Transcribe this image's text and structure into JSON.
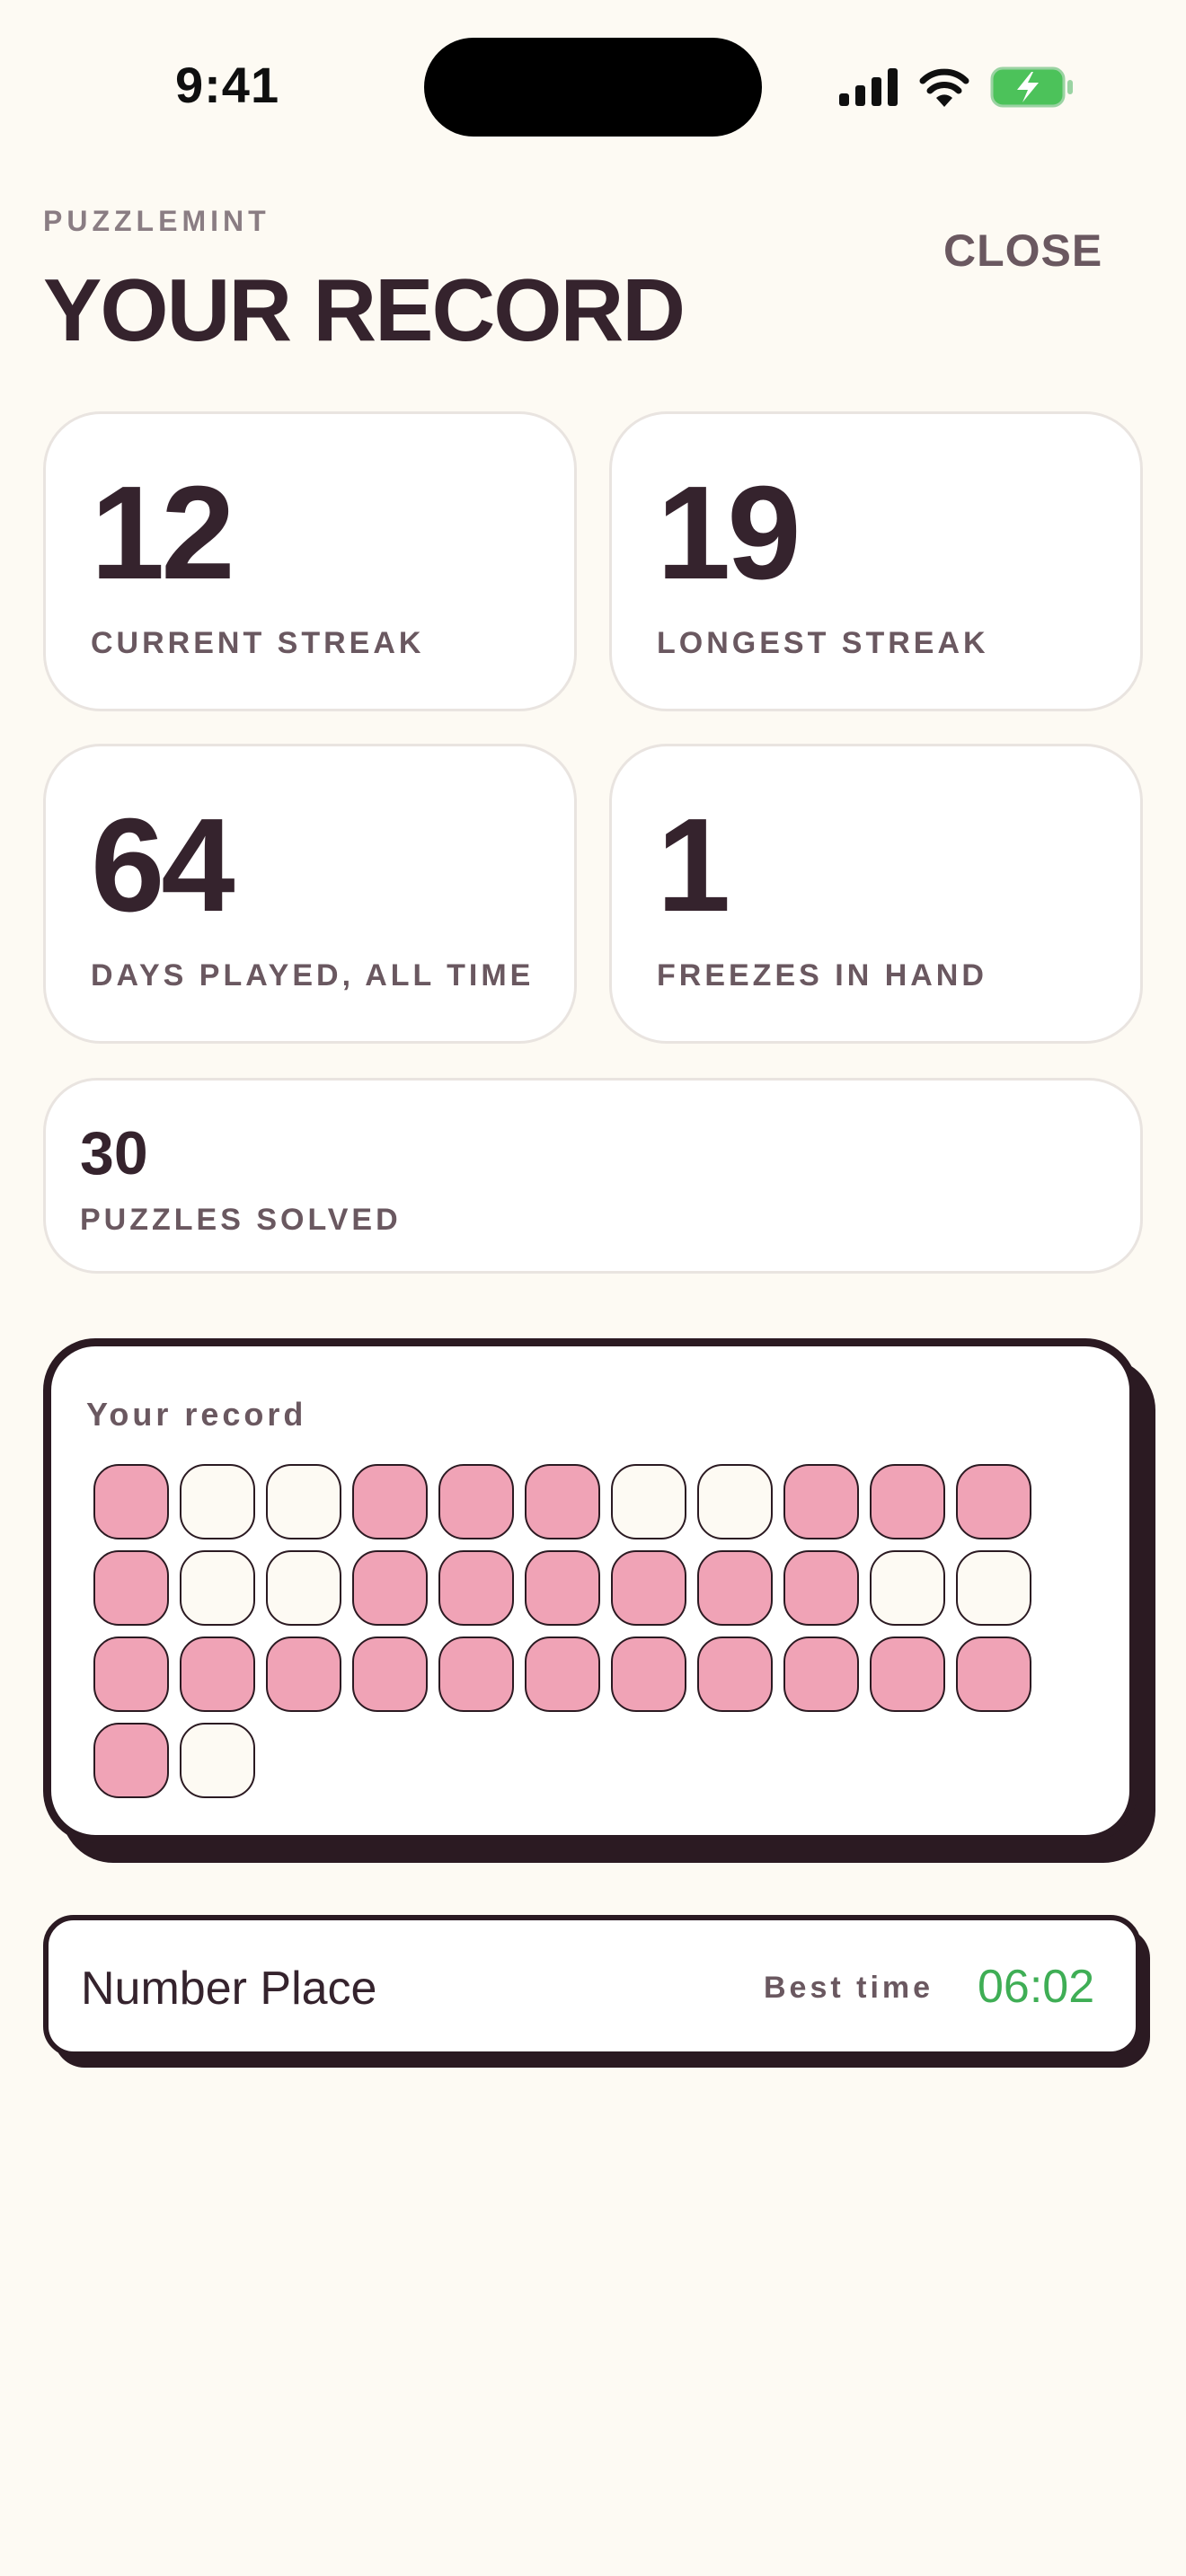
{
  "status_bar": {
    "time": "9:41",
    "icons": [
      "cellular-signal-icon",
      "wifi-icon",
      "battery-charging-icon"
    ],
    "battery_color": "#4CC25A"
  },
  "header": {
    "brand": "PUZZLEMINT",
    "title": "YOUR RECORD",
    "close_label": "CLOSE"
  },
  "stats": [
    {
      "value": "12",
      "label": "CURRENT STREAK"
    },
    {
      "value": "19",
      "label": "LONGEST STREAK"
    },
    {
      "value": "64",
      "label": "DAYS PLAYED, ALL TIME"
    },
    {
      "value": "1",
      "label": "FREEZES IN HAND"
    },
    {
      "value": "30",
      "label": "PUZZLES SOLVED"
    }
  ],
  "record": {
    "title": "Your record",
    "days": [
      1,
      0,
      0,
      1,
      1,
      1,
      0,
      0,
      1,
      1,
      1,
      1,
      0,
      0,
      1,
      1,
      1,
      1,
      1,
      1,
      0,
      0,
      1,
      1,
      1,
      1,
      1,
      1,
      1,
      1,
      1,
      1,
      1,
      1,
      0
    ],
    "played_color": "#F0A3B6",
    "missed_color": "#FDFAF3"
  },
  "best_time": {
    "puzzle": "Number Place",
    "label": "Best time",
    "value": "06:02",
    "value_color": "#3FAE55"
  }
}
